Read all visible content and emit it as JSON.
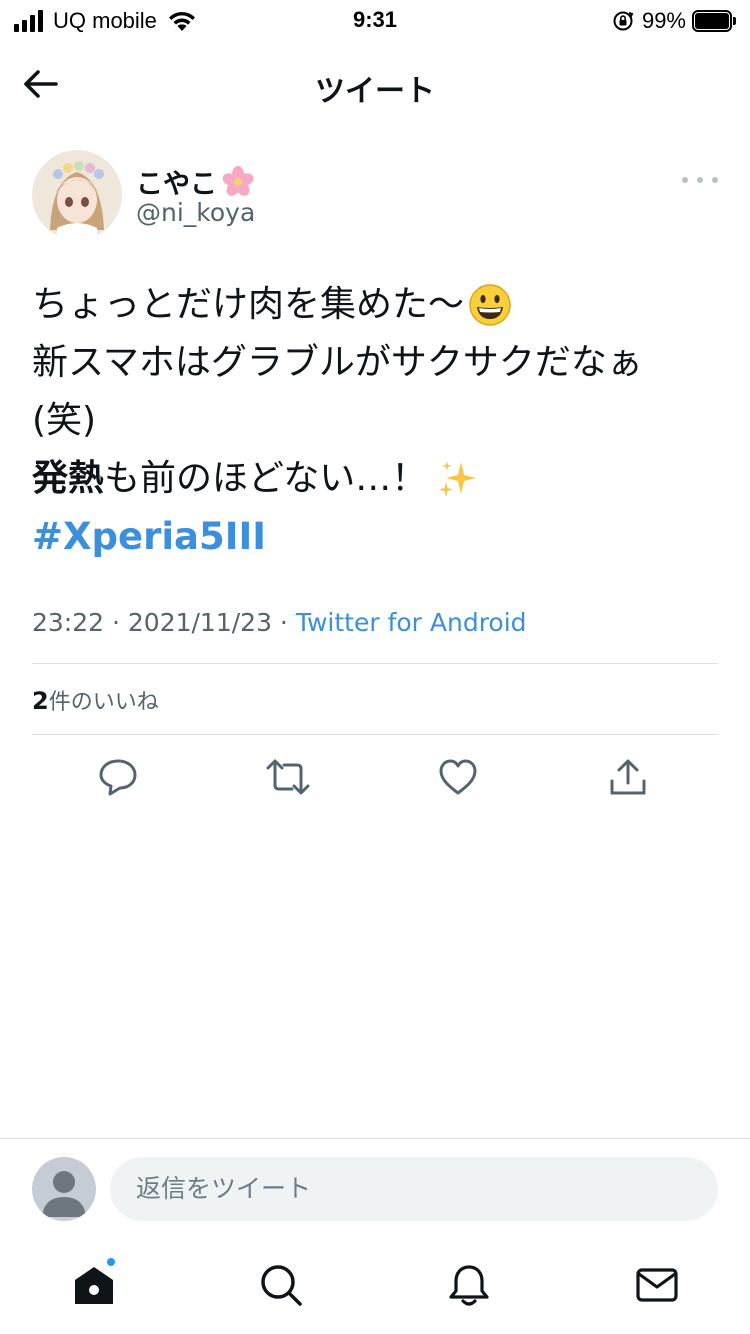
{
  "status_bar": {
    "carrier": "UQ mobile",
    "time": "9:31",
    "battery_percent": "99%",
    "battery_level": 0.99,
    "icons": [
      "signal-icon",
      "wifi-icon",
      "orientation-lock-icon",
      "battery-icon"
    ]
  },
  "header": {
    "title": "ツイート",
    "back_icon": "arrow-left-icon"
  },
  "tweet": {
    "author": {
      "display_name": "こやこ",
      "name_emoji": "cherry-blossom-icon",
      "handle": "@ni_koya"
    },
    "more_icon": "more-horizontal-icon",
    "lines": {
      "line1": "ちょっとだけ肉を集めた〜",
      "line2": "新スマホはグラブルがサクサクだなぁ",
      "line3": "(笑)",
      "line4_bold": "発熱",
      "line4_rest": "も前のほどない…！",
      "hashtag": "#Xperia5III"
    },
    "emojis": [
      "grinning-face-icon",
      "sparkles-icon"
    ],
    "time": "23:22",
    "separator": " · ",
    "date": "2021/11/23",
    "source": "Twitter for Android",
    "likes_count": "2",
    "likes_label": "件のいいね"
  },
  "actions": [
    "reply-icon",
    "retweet-icon",
    "like-icon",
    "share-icon"
  ],
  "reply_bar": {
    "placeholder": "返信をツイート"
  },
  "bottom_nav": [
    "home-icon",
    "search-icon",
    "notifications-icon",
    "messages-icon"
  ],
  "colors": {
    "accent": "#1d9bf0",
    "link": "#3b8fdc",
    "secondary_text": "#536471",
    "divider": "#dfe3e6"
  }
}
